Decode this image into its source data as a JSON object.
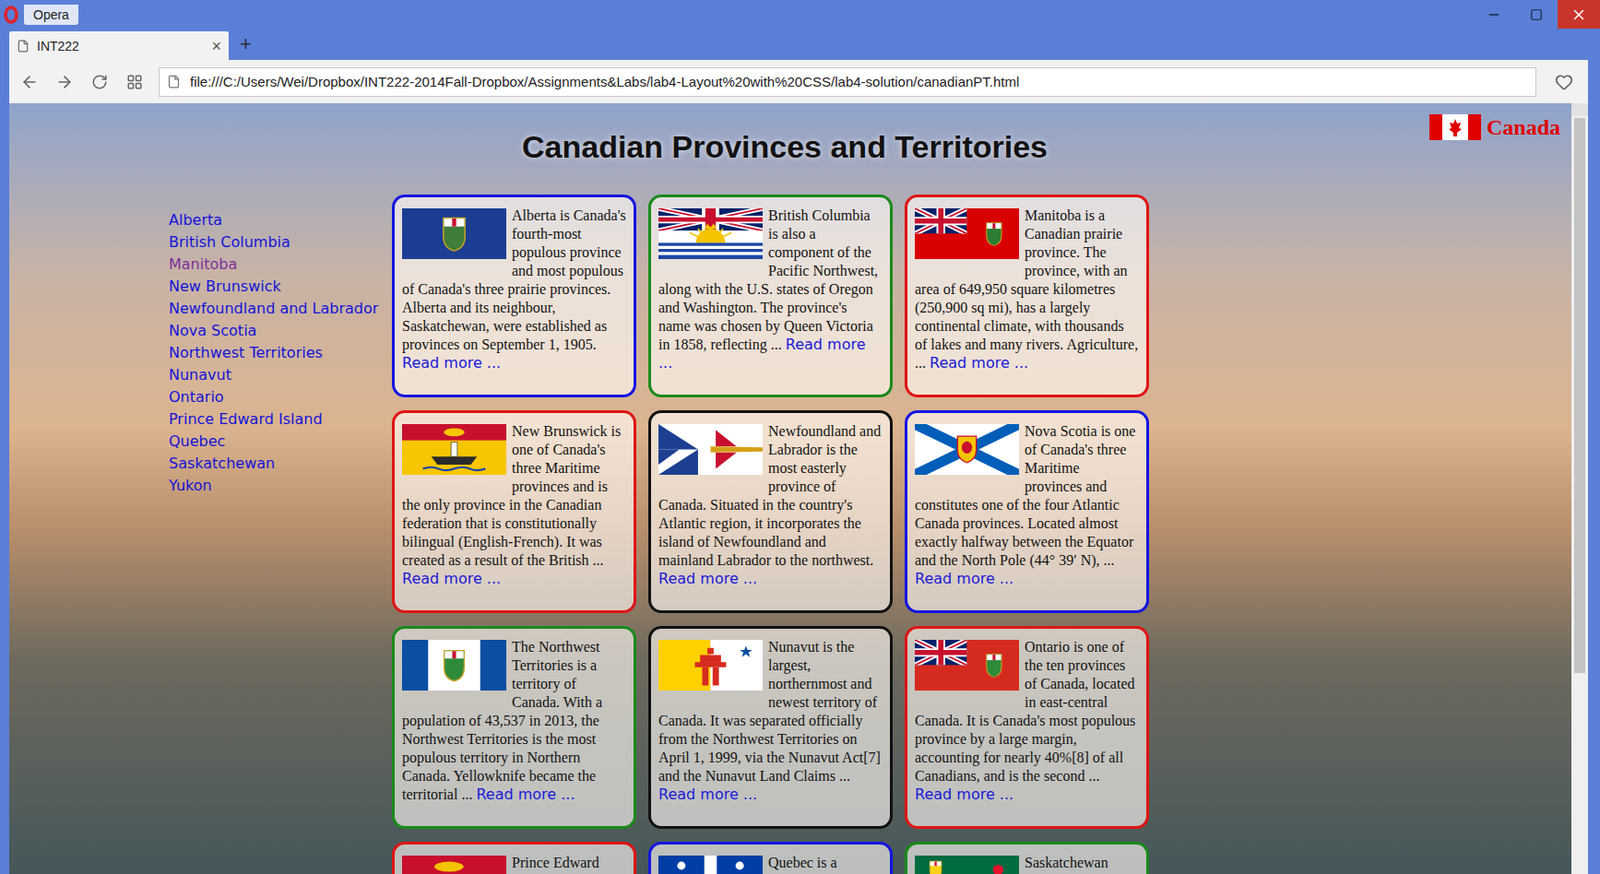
{
  "window": {
    "title": "Opera"
  },
  "tabs": [
    {
      "label": "INT222",
      "selected": true,
      "close": "×"
    }
  ],
  "new_tab": "+",
  "address_bar": {
    "url": "file:///C:/Users/Wei/Dropbox/INT222-2014Fall-Dropbox/Assignments&Labs/lab4-Layout%20with%20CSS/lab4-solution/canadianPT.html"
  },
  "page": {
    "heading": "Canadian Provinces and Territories",
    "logo": "Canada"
  },
  "nav": [
    {
      "label": "Alberta",
      "visited": false
    },
    {
      "label": "British Columbia",
      "visited": false
    },
    {
      "label": "Manitoba",
      "visited": true
    },
    {
      "label": "New Brunswick",
      "visited": false
    },
    {
      "label": "Newfoundland and Labrador",
      "visited": false
    },
    {
      "label": "Nova Scotia",
      "visited": false
    },
    {
      "label": "Northwest Territories",
      "visited": false
    },
    {
      "label": "Nunavut",
      "visited": false
    },
    {
      "label": "Ontario",
      "visited": false
    },
    {
      "label": "Prince Edward Island",
      "visited": false
    },
    {
      "label": "Quebec",
      "visited": false
    },
    {
      "label": "Saskatchewan",
      "visited": false
    },
    {
      "label": "Yukon",
      "visited": false
    }
  ],
  "cards": [
    {
      "kind": "alberta",
      "color": "#1414e0",
      "text": "Alberta is Canada's fourth-most populous province and most populous of Canada's three prairie provinces. Alberta and its neighbour, Saskatchewan, were established as provinces on September 1, 1905.",
      "link": "Read more ..."
    },
    {
      "kind": "bc",
      "color": "#1a8a1a",
      "text": "British Columbia is also a component of the Pacific Northwest, along with the U.S. states of Oregon and Washington. The province's name was chosen by Queen Victoria in 1858, reflecting ...",
      "link": "Read more ..."
    },
    {
      "kind": "manitoba",
      "color": "#e01414",
      "text": "Manitoba is a Canadian prairie province. The province, with an area of 649,950 square kilometres (250,900 sq mi), has a largely continental climate, with thousands of lakes and many rivers. Agriculture, ...",
      "link": "Read more ..."
    },
    {
      "kind": "nb",
      "color": "#e01414",
      "text": "New Brunswick is one of Canada's three Maritime provinces and is the only province in the Canadian federation that is constitutionally bilingual (English-French). It was created as a result of the British ...",
      "link": "Read more ..."
    },
    {
      "kind": "nl",
      "color": "#111111",
      "text": "Newfoundland and Labrador is the most easterly province of Canada. Situated in the country's Atlantic region, it incorporates the island of Newfoundland and mainland Labrador to the northwest.",
      "link": "Read more ..."
    },
    {
      "kind": "ns",
      "color": "#1414e0",
      "text": "Nova Scotia is one of Canada's three Maritime provinces and constitutes one of the four Atlantic Canada provinces. Located almost exactly halfway between the Equator and the North Pole (44° 39′ N), ...",
      "link": "Read more ..."
    },
    {
      "kind": "nwt",
      "color": "#1a8a1a",
      "text": "The Northwest Territories is a territory of Canada. With a population of 43,537 in 2013, the Northwest Territories is the most populous territory in Northern Canada. Yellowknife became the territorial ...",
      "link": "Read more ..."
    },
    {
      "kind": "nunavut",
      "color": "#111111",
      "text": "Nunavut is the largest, northernmost and newest territory of Canada. It was separated officially from the Northwest Territories on April 1, 1999, via the Nunavut Act[7] and the Nunavut Land Claims ...",
      "link": "Read more ..."
    },
    {
      "kind": "ontario",
      "color": "#e01414",
      "text": "Ontario is one of the ten provinces of Canada, located in east-central Canada. It is Canada's most populous province by a large margin, accounting for nearly 40%[8] of all Canadians, and is the second ...",
      "link": "Read more ..."
    },
    {
      "kind": "pei",
      "color": "#e01414",
      "text": "Prince Edward"
    },
    {
      "kind": "quebec",
      "color": "#1414e0",
      "text": "Quebec is a"
    },
    {
      "kind": "sask",
      "color": "#1a8a1a",
      "text": "Saskatchewan"
    }
  ]
}
